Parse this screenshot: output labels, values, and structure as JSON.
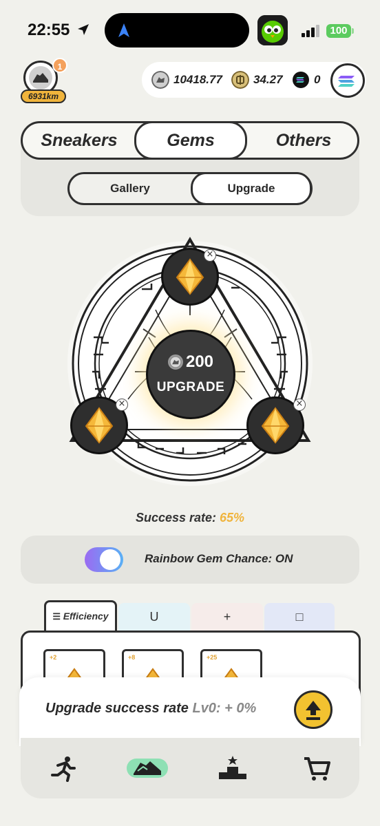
{
  "status_bar": {
    "time": "22:55",
    "battery": "100"
  },
  "profile": {
    "distance": "6931km",
    "notification_count": "1"
  },
  "currencies": [
    {
      "name": "gst",
      "icon": "gst-coin-icon",
      "value": "10418.77",
      "color": "#cfcfcf"
    },
    {
      "name": "gmt",
      "icon": "gmt-coin-icon",
      "value": "34.27",
      "color": "#d8c07a"
    },
    {
      "name": "sol",
      "icon": "sol-coin-icon",
      "value": "0",
      "color": "#111111"
    }
  ],
  "tabs": [
    {
      "label": "Sneakers",
      "active": false
    },
    {
      "label": "Gems",
      "active": true
    },
    {
      "label": "Others",
      "active": false
    }
  ],
  "subtabs": [
    {
      "label": "Gallery",
      "active": false
    },
    {
      "label": "Upgrade",
      "active": true
    }
  ],
  "upgrade": {
    "cost": "200",
    "label": "UPGRADE"
  },
  "success": {
    "label": "Success rate:",
    "value": "65%"
  },
  "rainbow": {
    "label": "Rainbow Gem Chance: ON",
    "enabled": true
  },
  "stat_tabs": [
    {
      "label": "Efficiency",
      "icon": "efficiency-icon",
      "active": true,
      "bg": "#ffffff"
    },
    {
      "label": "",
      "icon": "luck-icon",
      "glyph": "U",
      "active": false,
      "bg": "#e4f3f7"
    },
    {
      "label": "",
      "icon": "comfort-icon",
      "glyph": "+",
      "active": false,
      "bg": "#f6ecea"
    },
    {
      "label": "",
      "icon": "resilience-icon",
      "glyph": "□",
      "active": false,
      "bg": "#e3e8f7"
    }
  ],
  "gem_cards": [
    {
      "bonus": "+2"
    },
    {
      "bonus": "+8"
    },
    {
      "bonus": "+25"
    }
  ],
  "upgrade_rate": {
    "label": "Upgrade success rate",
    "level": "Lv0: + 0%"
  },
  "nav": [
    {
      "name": "run",
      "icon": "running-icon"
    },
    {
      "name": "sneakers",
      "icon": "sneaker-icon"
    },
    {
      "name": "leaderboard",
      "icon": "podium-icon"
    },
    {
      "name": "shop",
      "icon": "cart-icon"
    }
  ],
  "colors": {
    "accent": "#f0b43c",
    "gem_gold": "#f5b83a",
    "toggle_start": "#9b6bf2",
    "toggle_end": "#5ab0f5"
  }
}
